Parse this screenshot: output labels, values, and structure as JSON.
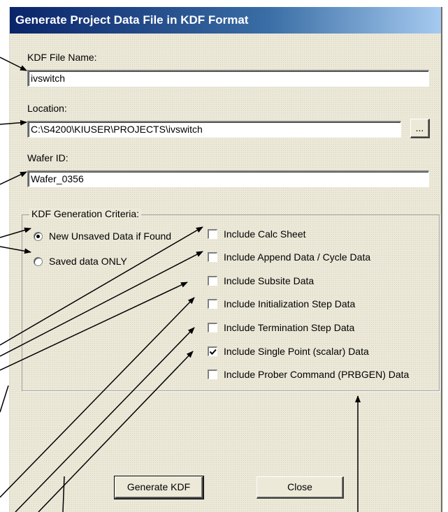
{
  "window": {
    "title": "Generate Project Data File in KDF Format"
  },
  "kdf_file_name": {
    "label": "KDF File Name:",
    "value": "ivswitch"
  },
  "location": {
    "label": "Location:",
    "value": "C:\\S4200\\KIUSER\\PROJECTS\\ivswitch",
    "browse_label": "..."
  },
  "wafer_id": {
    "label": "Wafer ID:",
    "value": "Wafer_0356"
  },
  "criteria": {
    "title": "KDF Generation Criteria:",
    "radios": [
      {
        "label": "New Unsaved Data if Found",
        "selected": true
      },
      {
        "label": "Saved data ONLY",
        "selected": false
      }
    ],
    "checkboxes": [
      {
        "label": "Include Calc Sheet",
        "checked": false
      },
      {
        "label": "Include Append Data / Cycle Data",
        "checked": false
      },
      {
        "label": "Include Subsite Data",
        "checked": false
      },
      {
        "label": "Include Initialization Step Data",
        "checked": false
      },
      {
        "label": "Include Termination Step Data",
        "checked": false
      },
      {
        "label": "Include Single Point (scalar) Data",
        "checked": true
      },
      {
        "label": "Include Prober Command (PRBGEN) Data",
        "checked": false
      }
    ]
  },
  "buttons": {
    "generate_label": "Generate KDF",
    "close_label": "Close"
  },
  "colors": {
    "dialog_bg": "#ece9d8",
    "title_start": "#0a246a",
    "title_end": "#a6caf0",
    "title_text": "#ffffff"
  }
}
